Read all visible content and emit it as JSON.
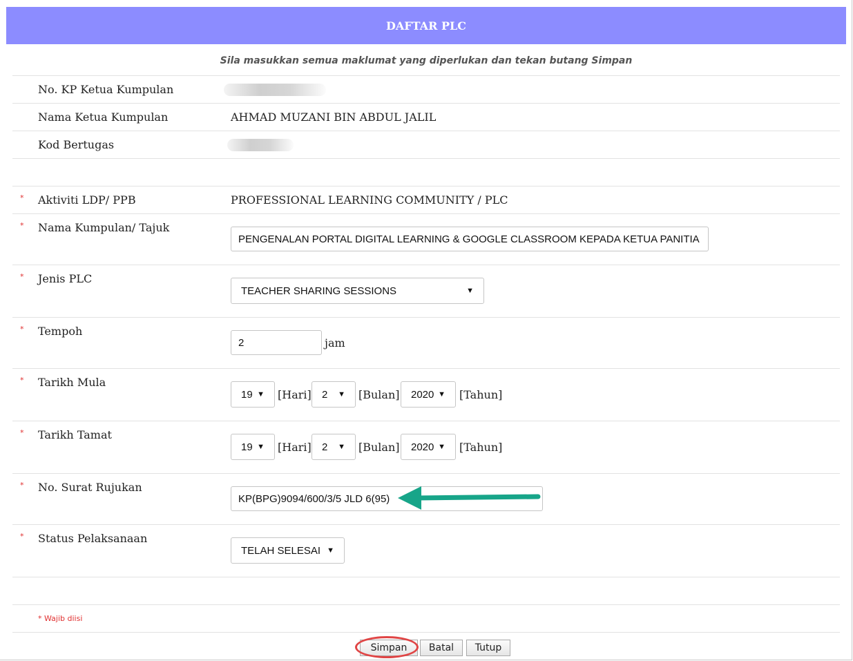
{
  "header": {
    "title": "DAFTAR PLC"
  },
  "instruction": "Sila masukkan semua maklumat yang diperlukan dan tekan butang Simpan",
  "required_marker": "*",
  "fields": {
    "no_kp": {
      "label": "No. KP Ketua Kumpulan"
    },
    "nama_ketua": {
      "label": "Nama Ketua Kumpulan",
      "value": "AHMAD MUZANI BIN ABDUL JALIL"
    },
    "kod_bertugas": {
      "label": "Kod Bertugas"
    },
    "aktiviti": {
      "label": "Aktiviti LDP/ PPB",
      "value": "PROFESSIONAL LEARNING COMMUNITY / PLC"
    },
    "nama_kumpulan": {
      "label": "Nama Kumpulan/ Tajuk",
      "value": "PENGENALAN PORTAL DIGITAL LEARNING & GOOGLE CLASSROOM KEPADA KETUA PANITIA"
    },
    "jenis_plc": {
      "label": "Jenis PLC",
      "value": "TEACHER SHARING SESSIONS"
    },
    "tempoh": {
      "label": "Tempoh",
      "value": "2",
      "unit": "jam"
    },
    "tarikh_mula": {
      "label": "Tarikh Mula",
      "day": "19",
      "month": "2",
      "year": "2020",
      "day_unit": "[Hari]",
      "month_unit": "[Bulan]",
      "year_unit": "[Tahun]"
    },
    "tarikh_tamat": {
      "label": "Tarikh Tamat",
      "day": "19",
      "month": "2",
      "year": "2020",
      "day_unit": "[Hari]",
      "month_unit": "[Bulan]",
      "year_unit": "[Tahun]"
    },
    "no_surat": {
      "label": "No. Surat Rujukan",
      "value": "KP(BPG)9094/600/3/5 JLD 6(95)"
    },
    "status": {
      "label": "Status Pelaksanaan",
      "value": "TELAH SELESAI"
    }
  },
  "note": "* Wajib diisi",
  "buttons": {
    "save": "Simpan",
    "cancel": "Batal",
    "close": "Tutup"
  },
  "colors": {
    "header_bg": "#8c8cff",
    "arrow": "#17a589",
    "highlight_ring": "#e04545",
    "required": "#e03030"
  },
  "caret_glyph": "▼"
}
